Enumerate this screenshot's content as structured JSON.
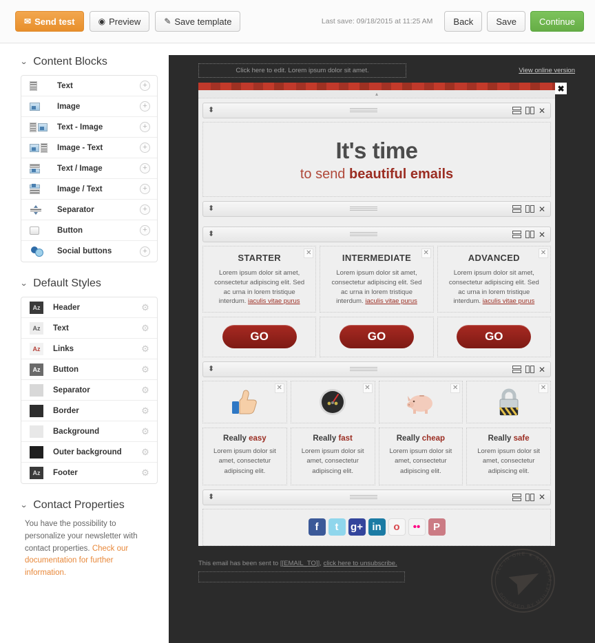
{
  "toolbar": {
    "send_test": "Send test",
    "send_test_icon": "envelope-icon",
    "preview": "Preview",
    "preview_icon": "eye-icon",
    "save_template": "Save template",
    "save_template_icon": "pencil-icon",
    "last_save": "Last save: 09/18/2015 at 11:25 AM",
    "back": "Back",
    "save": "Save",
    "continue": "Continue",
    "orange": "#e89234",
    "green": "#6fb64d"
  },
  "sidebar": {
    "content_blocks": {
      "title": "Content Blocks",
      "add_label": "+",
      "items": [
        {
          "label": "Text",
          "icon": "text-block-icon"
        },
        {
          "label": "Image",
          "icon": "image-block-icon"
        },
        {
          "label": "Text - Image",
          "icon": "text-image-block-icon"
        },
        {
          "label": "Image - Text",
          "icon": "image-text-block-icon"
        },
        {
          "label": "Text / Image",
          "icon": "text-over-image-block-icon"
        },
        {
          "label": "Image / Text",
          "icon": "image-over-text-block-icon"
        },
        {
          "label": "Separator",
          "icon": "separator-block-icon"
        },
        {
          "label": "Button",
          "icon": "button-block-icon"
        },
        {
          "label": "Social buttons",
          "icon": "social-buttons-block-icon"
        }
      ]
    },
    "default_styles": {
      "title": "Default Styles",
      "gear_icon": "gear-icon",
      "items": [
        {
          "label": "Header",
          "swatch": "#3a3a3a",
          "glyph": "Az",
          "glyph_color": "#d8d8d8"
        },
        {
          "label": "Text",
          "swatch": "#ededed",
          "glyph": "Az",
          "glyph_color": "#5a5a5a"
        },
        {
          "label": "Links",
          "swatch": "#f2f2f2",
          "glyph": "Az",
          "glyph_color": "#b5433a"
        },
        {
          "label": "Button",
          "swatch": "#6b6b6b",
          "glyph": "Az",
          "glyph_color": "#ffffff"
        },
        {
          "label": "Separator",
          "swatch": "#d8d8d8",
          "glyph": "",
          "glyph_color": "#000000"
        },
        {
          "label": "Border",
          "swatch": "#2e2e2e",
          "glyph": "",
          "glyph_color": "#000000"
        },
        {
          "label": "Background",
          "swatch": "#e8e8e8",
          "glyph": "",
          "glyph_color": "#000000"
        },
        {
          "label": "Outer background",
          "swatch": "#1f1f1f",
          "glyph": "",
          "glyph_color": "#000000"
        },
        {
          "label": "Footer",
          "swatch": "#3a3a3a",
          "glyph": "Az",
          "glyph_color": "#d8d8d8"
        }
      ]
    },
    "contact_properties": {
      "title": "Contact Properties",
      "text": "You have the possibility to personalize your newsletter with contact properties. ",
      "link": "Check our documentation for further information."
    }
  },
  "preview": {
    "preheader": "Click here to edit. Lorem ipsum dolor sit amet.",
    "view_online": "View online version",
    "close_icon": "close-icon",
    "block_toolbar": {
      "move_icon": "move-vertical-icon",
      "grip_icon": "drag-grip-icon",
      "rows_icon": "split-rows-icon",
      "columns_icon": "split-columns-icon",
      "remove_icon": "close-icon"
    },
    "hero": {
      "line1": "It's time",
      "line2_plain": "to send ",
      "line2_bold": "beautiful emails"
    },
    "tiers": [
      {
        "title": "STARTER",
        "body": "Lorem ipsum dolor sit amet, consectetur adipiscing elit. Sed ac urna in lorem tristique interdum. ",
        "link": "iaculis vitae purus",
        "button": "GO"
      },
      {
        "title": "INTERMEDIATE",
        "body": "Lorem ipsum dolor sit amet, consectetur adipiscing elit. Sed ac urna in lorem tristique interdum. ",
        "link": "iaculis vitae purus",
        "button": "GO"
      },
      {
        "title": "ADVANCED",
        "body": "Lorem ipsum dolor sit amet, consectetur adipiscing elit. Sed ac urna in lorem tristique interdum. ",
        "link": "iaculis vitae purus",
        "button": "GO"
      }
    ],
    "features": [
      {
        "title_plain": "Really ",
        "title_hl": "easy",
        "body": "Lorem ipsum dolor sit amet, consectetur adipiscing elit.",
        "icon": "thumbs-up-icon"
      },
      {
        "title_plain": "Really ",
        "title_hl": "fast",
        "body": "Lorem ipsum dolor sit amet, consectetur adipiscing elit.",
        "icon": "speedometer-icon"
      },
      {
        "title_plain": "Really ",
        "title_hl": "cheap",
        "body": "Lorem ipsum dolor sit amet, consectetur adipiscing elit.",
        "icon": "piggy-bank-icon"
      },
      {
        "title_plain": "Really ",
        "title_hl": "safe",
        "body": "Lorem ipsum dolor sit amet, consectetur adipiscing elit.",
        "icon": "padlock-icon"
      }
    ],
    "social": [
      {
        "name": "facebook-icon",
        "glyph": "f",
        "color": "#3b5998"
      },
      {
        "name": "twitter-icon",
        "glyph": "t",
        "color": "#8fd6ec"
      },
      {
        "name": "google-plus-icon",
        "glyph": "g+",
        "color": "#33459c"
      },
      {
        "name": "linkedin-icon",
        "glyph": "in",
        "color": "#1b7ba4"
      },
      {
        "name": "orkut-icon",
        "glyph": "o",
        "color": "#f6f6f6"
      },
      {
        "name": "flickr-icon",
        "glyph": "••",
        "color": "#f4f4f4"
      },
      {
        "name": "pinterest-icon",
        "glyph": "P",
        "color": "#cb7b84"
      }
    ],
    "footer": {
      "text_before": "This email has been sent to ",
      "email_token": "[[EMAIL_TO]]",
      "text_mid": ", ",
      "unsubscribe": "click here to unsubscribe."
    },
    "stamp": {
      "top_text": "ALL IN ONE ★ ANTI SPAM ★",
      "bottom_text": "POWERED BY MAILJET",
      "icon": "paper-plane-icon"
    }
  }
}
